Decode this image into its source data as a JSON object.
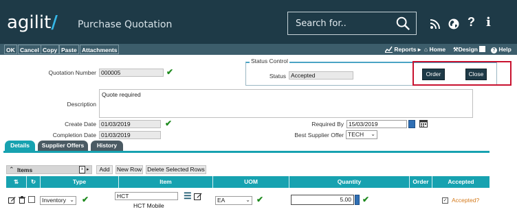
{
  "header": {
    "logo_text": "agilit",
    "logo_slash": "/",
    "app_title": "Purchase Quotation",
    "search_placeholder": "Search for..",
    "icons": [
      "rss-icon",
      "globe-icon",
      "help-icon",
      "info-icon"
    ],
    "colors": {
      "bg": "#1e3a47",
      "accent": "#35b6e6"
    }
  },
  "toolbar": {
    "buttons": [
      "OK",
      "Cancel",
      "Copy",
      "Paste",
      "Attachments"
    ],
    "right": {
      "reports": "Reports",
      "home": "Home",
      "design": "Design",
      "help": "Help"
    }
  },
  "form": {
    "quotation_number_label": "Quotation Number",
    "quotation_number": "000005",
    "status_control_legend": "Status Control",
    "status_label": "Status",
    "status_value": "Accepted",
    "order_button": "Order",
    "close_button": "Close",
    "description_label": "Description",
    "description_value": "Quote required",
    "create_date_label": "Create Date",
    "create_date": "01/03/2019",
    "completion_date_label": "Completion Date",
    "completion_date": "01/03/2019",
    "required_by_label": "Required By",
    "required_by": "15/03/2019",
    "best_supplier_label": "Best Supplier Offer",
    "best_supplier_value": "TECH"
  },
  "tabs": [
    {
      "label": "Details",
      "active": true
    },
    {
      "label": "Supplier Offers",
      "active": false
    },
    {
      "label": "History",
      "active": false
    }
  ],
  "items": {
    "title": "Items",
    "add_button": "Add",
    "new_row_button": "New Row",
    "delete_button": "Delete Selected Rows",
    "columns": [
      "Type",
      "Item",
      "UOM",
      "Quantity",
      "Order",
      "Accepted"
    ],
    "rows": [
      {
        "type": "Inventory",
        "item_code": "HCT",
        "item_name": "HCT Mobile",
        "uom": "EA",
        "quantity": "5.00",
        "accepted": "Accepted?"
      }
    ]
  }
}
